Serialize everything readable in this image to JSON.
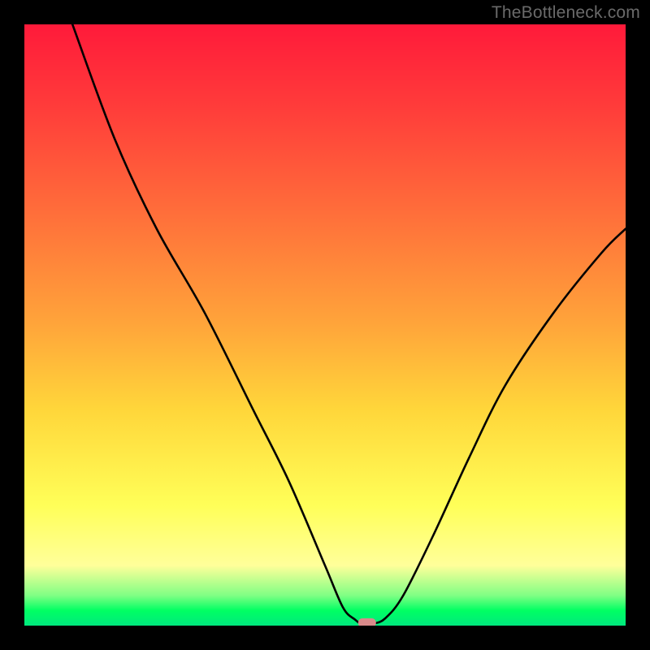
{
  "watermark": "TheBottleneck.com",
  "chart_data": {
    "type": "line",
    "title": "",
    "xlabel": "",
    "ylabel": "",
    "xlim": [
      0,
      100
    ],
    "ylim": [
      0,
      100
    ],
    "grid": false,
    "legend": false,
    "series": [
      {
        "name": "bottleneck-curve",
        "color": "#000000",
        "x": [
          8,
          15,
          22,
          30,
          38,
          44,
          50,
          53,
          55,
          56.5,
          58,
          60,
          63,
          68,
          74,
          80,
          88,
          96,
          100
        ],
        "y": [
          100,
          81,
          66,
          52,
          36,
          24,
          10,
          3,
          1,
          0,
          0.3,
          1.2,
          5,
          15,
          28,
          40,
          52,
          62,
          66
        ]
      }
    ],
    "marker": {
      "name": "optimum-marker",
      "shape": "rounded-rect",
      "x": 57,
      "y": 0,
      "color": "#d98a8a"
    },
    "background_gradient": {
      "stops": [
        {
          "pos": 0.0,
          "color": "#ff1a3a"
        },
        {
          "pos": 0.5,
          "color": "#ffa53a"
        },
        {
          "pos": 0.8,
          "color": "#ffff58"
        },
        {
          "pos": 0.95,
          "color": "#7fff84"
        },
        {
          "pos": 1.0,
          "color": "#00e87e"
        }
      ]
    }
  }
}
